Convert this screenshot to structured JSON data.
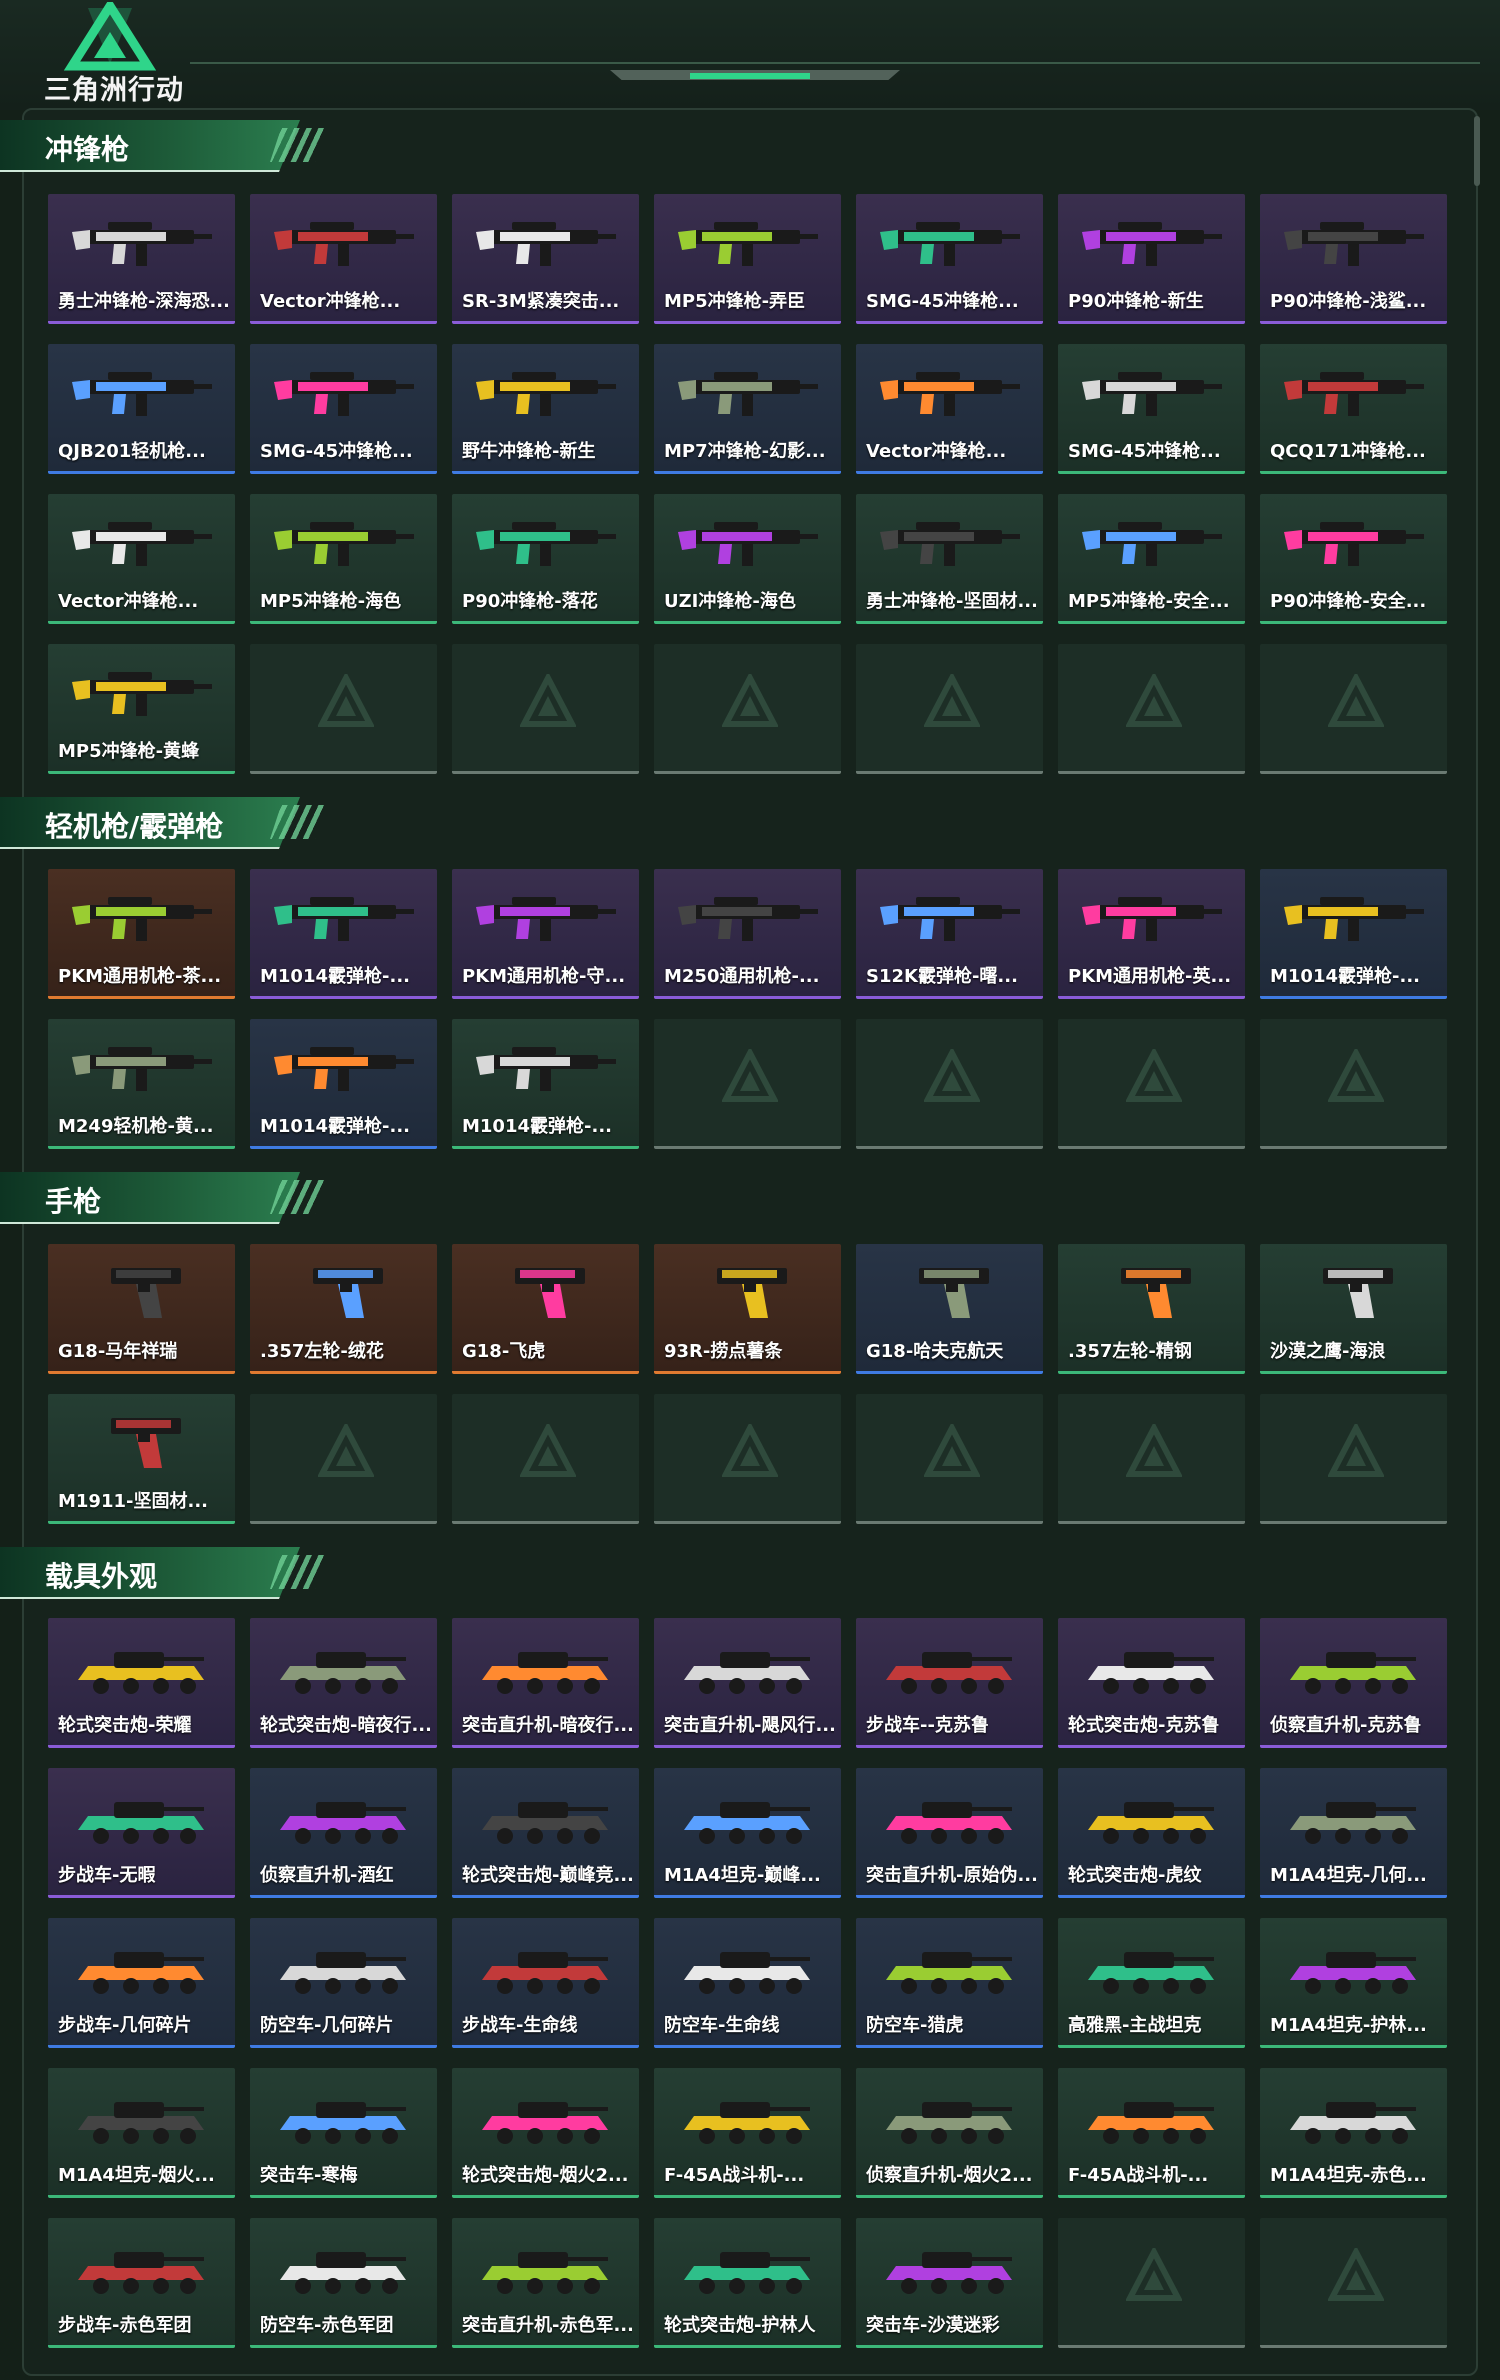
{
  "logo": {
    "text": "三角洲行动",
    "icon": "delta-triangle-logo-icon"
  },
  "rarity_colors": {
    "purple": "#8a5cd8",
    "blue": "#3f7be3",
    "green": "#3cb879",
    "orange": "#e07a30",
    "empty": "#6a7a72"
  },
  "sections": [
    {
      "title": "冲锋枪",
      "kind": "gun",
      "items": [
        {
          "name": "勇士冲锋枪-深海恐...",
          "rarity": "purple"
        },
        {
          "name": "Vector冲锋枪...",
          "rarity": "purple"
        },
        {
          "name": "SR-3M紧凑突击...",
          "rarity": "purple"
        },
        {
          "name": "MP5冲锋枪-弄臣",
          "rarity": "purple"
        },
        {
          "name": "SMG-45冲锋枪...",
          "rarity": "purple"
        },
        {
          "name": "P90冲锋枪-新生",
          "rarity": "purple"
        },
        {
          "name": "P90冲锋枪-浅鲨...",
          "rarity": "purple"
        },
        {
          "name": "QJB201轻机枪...",
          "rarity": "blue"
        },
        {
          "name": "SMG-45冲锋枪...",
          "rarity": "blue"
        },
        {
          "name": "野牛冲锋枪-新生",
          "rarity": "blue"
        },
        {
          "name": "MP7冲锋枪-幻影...",
          "rarity": "blue"
        },
        {
          "name": "Vector冲锋枪...",
          "rarity": "blue"
        },
        {
          "name": "SMG-45冲锋枪...",
          "rarity": "green"
        },
        {
          "name": "QCQ171冲锋枪...",
          "rarity": "green"
        },
        {
          "name": "Vector冲锋枪...",
          "rarity": "green"
        },
        {
          "name": "MP5冲锋枪-海色",
          "rarity": "green"
        },
        {
          "name": "P90冲锋枪-落花",
          "rarity": "green"
        },
        {
          "name": "UZI冲锋枪-海色",
          "rarity": "green"
        },
        {
          "name": "勇士冲锋枪-坚固材...",
          "rarity": "green"
        },
        {
          "name": "MP5冲锋枪-安全...",
          "rarity": "green"
        },
        {
          "name": "P90冲锋枪-安全...",
          "rarity": "green"
        },
        {
          "name": "MP5冲锋枪-黄蜂",
          "rarity": "green"
        },
        {
          "name": "",
          "rarity": "empty"
        },
        {
          "name": "",
          "rarity": "empty"
        },
        {
          "name": "",
          "rarity": "empty"
        },
        {
          "name": "",
          "rarity": "empty"
        },
        {
          "name": "",
          "rarity": "empty"
        },
        {
          "name": "",
          "rarity": "empty"
        }
      ]
    },
    {
      "title": "轻机枪/霰弹枪",
      "kind": "gun",
      "items": [
        {
          "name": "PKM通用机枪-茶...",
          "rarity": "orange"
        },
        {
          "name": "M1014霰弹枪-...",
          "rarity": "purple"
        },
        {
          "name": "PKM通用机枪-守...",
          "rarity": "purple"
        },
        {
          "name": "M250通用机枪-...",
          "rarity": "purple"
        },
        {
          "name": "S12K霰弹枪-曙...",
          "rarity": "purple"
        },
        {
          "name": "PKM通用机枪-英...",
          "rarity": "purple"
        },
        {
          "name": "M1014霰弹枪-...",
          "rarity": "blue"
        },
        {
          "name": "M249轻机枪-黄...",
          "rarity": "green"
        },
        {
          "name": "M1014霰弹枪-...",
          "rarity": "blue"
        },
        {
          "name": "M1014霰弹枪-...",
          "rarity": "green"
        },
        {
          "name": "",
          "rarity": "empty"
        },
        {
          "name": "",
          "rarity": "empty"
        },
        {
          "name": "",
          "rarity": "empty"
        },
        {
          "name": "",
          "rarity": "empty"
        }
      ]
    },
    {
      "title": "手枪",
      "kind": "pistol",
      "items": [
        {
          "name": "G18-马年祥瑞",
          "rarity": "orange"
        },
        {
          "name": ".357左轮-绒花",
          "rarity": "orange"
        },
        {
          "name": "G18-飞虎",
          "rarity": "orange"
        },
        {
          "name": "93R-捞点薯条",
          "rarity": "orange"
        },
        {
          "name": "G18-哈夫克航天",
          "rarity": "blue"
        },
        {
          "name": ".357左轮-精钢",
          "rarity": "green"
        },
        {
          "name": "沙漠之鹰-海浪",
          "rarity": "green"
        },
        {
          "name": "M1911-坚固材...",
          "rarity": "green"
        },
        {
          "name": "",
          "rarity": "empty"
        },
        {
          "name": "",
          "rarity": "empty"
        },
        {
          "name": "",
          "rarity": "empty"
        },
        {
          "name": "",
          "rarity": "empty"
        },
        {
          "name": "",
          "rarity": "empty"
        },
        {
          "name": "",
          "rarity": "empty"
        }
      ]
    },
    {
      "title": "载具外观",
      "kind": "vehicle",
      "items": [
        {
          "name": "轮式突击炮-荣耀",
          "rarity": "purple"
        },
        {
          "name": "轮式突击炮-暗夜行...",
          "rarity": "purple"
        },
        {
          "name": "突击直升机-暗夜行...",
          "rarity": "purple"
        },
        {
          "name": "突击直升机-飓风行...",
          "rarity": "purple"
        },
        {
          "name": "步战车--克苏鲁",
          "rarity": "purple"
        },
        {
          "name": "轮式突击炮-克苏鲁",
          "rarity": "purple"
        },
        {
          "name": "侦察直升机-克苏鲁",
          "rarity": "purple"
        },
        {
          "name": "步战车-无暇",
          "rarity": "purple"
        },
        {
          "name": "侦察直升机-酒红",
          "rarity": "blue"
        },
        {
          "name": "轮式突击炮-巅峰竞...",
          "rarity": "blue"
        },
        {
          "name": "M1A4坦克-巅峰...",
          "rarity": "blue"
        },
        {
          "name": "突击直升机-原始伪...",
          "rarity": "blue"
        },
        {
          "name": "轮式突击炮-虎纹",
          "rarity": "blue"
        },
        {
          "name": "M1A4坦克-几何...",
          "rarity": "blue"
        },
        {
          "name": "步战车-几何碎片",
          "rarity": "blue"
        },
        {
          "name": "防空车-几何碎片",
          "rarity": "blue"
        },
        {
          "name": "步战车-生命线",
          "rarity": "blue"
        },
        {
          "name": "防空车-生命线",
          "rarity": "blue"
        },
        {
          "name": "防空车-猎虎",
          "rarity": "blue"
        },
        {
          "name": "高雅黑-主战坦克",
          "rarity": "green"
        },
        {
          "name": "M1A4坦克-护林...",
          "rarity": "green"
        },
        {
          "name": "M1A4坦克-烟火...",
          "rarity": "green"
        },
        {
          "name": "突击车-寒梅",
          "rarity": "green"
        },
        {
          "name": "轮式突击炮-烟火2...",
          "rarity": "green"
        },
        {
          "name": "F-45A战斗机-...",
          "rarity": "green"
        },
        {
          "name": "侦察直升机-烟火2...",
          "rarity": "green"
        },
        {
          "name": "F-45A战斗机-...",
          "rarity": "green"
        },
        {
          "name": "M1A4坦克-赤色...",
          "rarity": "green"
        },
        {
          "name": "步战车-赤色军团",
          "rarity": "green"
        },
        {
          "name": "防空车-赤色军团",
          "rarity": "green"
        },
        {
          "name": "突击直升机-赤色军...",
          "rarity": "green"
        },
        {
          "name": "轮式突击炮-护林人",
          "rarity": "green"
        },
        {
          "name": "突击车-沙漠迷彩",
          "rarity": "green"
        },
        {
          "name": "",
          "rarity": "empty"
        },
        {
          "name": "",
          "rarity": "empty"
        }
      ]
    }
  ]
}
